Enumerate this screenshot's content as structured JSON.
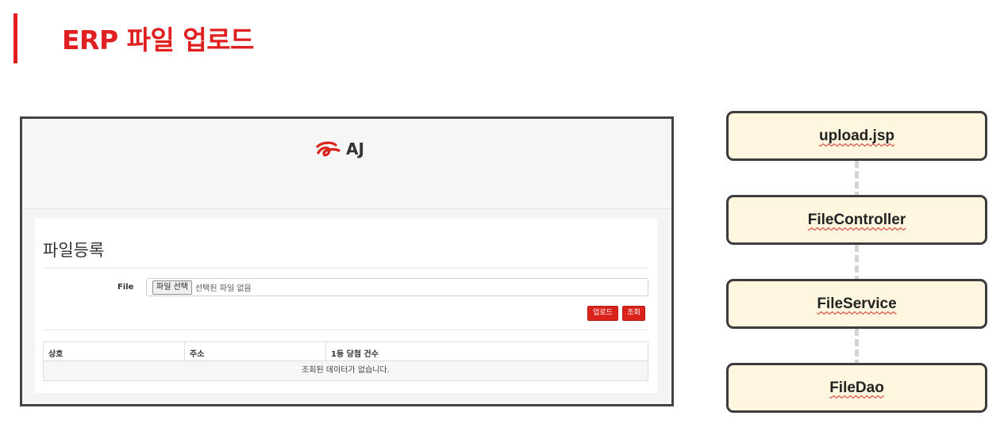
{
  "slide": {
    "title": "ERP 파일 업로드",
    "accent_color": "#e02020"
  },
  "app": {
    "logo": {
      "icon": "aj-logo-icon",
      "text": "AJ"
    },
    "panel_title": "파일등록",
    "file_field": {
      "label": "File",
      "button_label": "파일 선택",
      "status": "선택된 파일 없음"
    },
    "buttons": {
      "upload": "업로드",
      "query": "조회"
    },
    "table": {
      "columns": [
        "상호",
        "주소",
        "1등 당첨 건수"
      ],
      "empty_message": "조회된 데이터가 없습니다."
    }
  },
  "flow": {
    "items": [
      {
        "label": "upload.jsp"
      },
      {
        "label": "FileController"
      },
      {
        "label": "FileService"
      },
      {
        "label": "FileDao"
      }
    ]
  }
}
